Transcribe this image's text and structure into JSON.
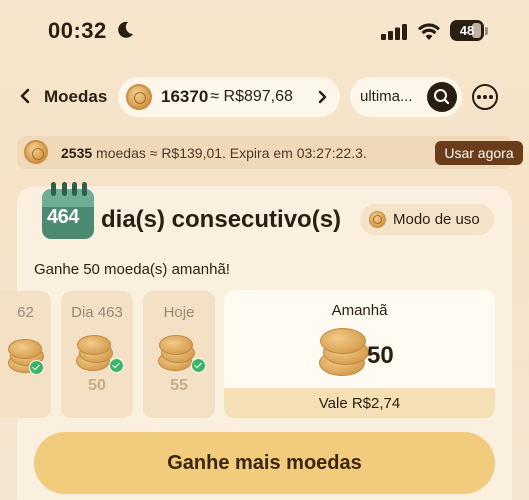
{
  "status_bar": {
    "time": "00:32",
    "battery": "48"
  },
  "nav": {
    "back_icon": "chevron-left-icon",
    "title": "Moedas",
    "balance_coins": "16370",
    "balance_value": "≈ R$897,68",
    "search_text": "ultima...",
    "more_icon": "more-horizontal-icon"
  },
  "expiry_banner": {
    "coins": "2535",
    "text": " moedas ≈ R$139,01. Expira em 03:27:22.3.",
    "button_label": "Usar agora"
  },
  "checkin": {
    "streak_number": "464",
    "streak_title": "dia(s) consecutivo(s)",
    "howto_label": "Modo de uso",
    "hint": "Ganhe 50 moeda(s) amanhã!",
    "days": [
      {
        "label": "62",
        "value": "",
        "claimed": true
      },
      {
        "label": "Dia 463",
        "value": "50",
        "claimed": true
      },
      {
        "label": "Hoje",
        "value": "55",
        "claimed": true
      }
    ],
    "tomorrow": {
      "label": "Amanhã",
      "amount": "50",
      "footer": "Vale R$2,74"
    }
  },
  "earn_more_button": "Ganhe mais moedas",
  "colors": {
    "accent_brown": "#6b3c1a",
    "button_gold": "#f1cc7d",
    "check_green": "#3db36a",
    "calendar_green": "#5f9e86"
  }
}
